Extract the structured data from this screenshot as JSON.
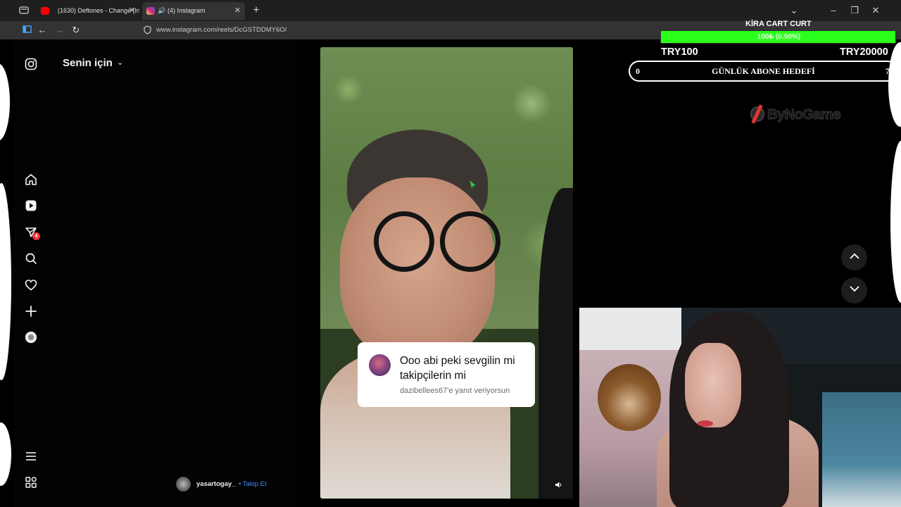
{
  "browser": {
    "tabs": [
      {
        "title": "(1630) Deftones - Change (In T",
        "favicon_color": "#ff0000"
      },
      {
        "title": "(4) Instagram",
        "favicon_color": "#d6249f"
      }
    ],
    "url": "www.instagram.com/reels/DcGSTDDMY6O/"
  },
  "instagram": {
    "feed_title": "Senin için",
    "notification_badge": "4",
    "comment": {
      "text": "Ooo abi peki sevgilin mi takipçilerin  mi",
      "reply_note": "dazibellees67'e yanıt veriyorsun"
    },
    "author": {
      "username": "yasartogay_",
      "follow_label": "• Takip Et"
    }
  },
  "overlay": {
    "goal": {
      "label": "KİRA CART CURT",
      "percent_text": "100₺ (0.50%)",
      "progress_fraction": 0.005,
      "min": "TRY100",
      "max": "TRY20000",
      "bar_color": "#2bff1c"
    },
    "subgoal": {
      "current": "0",
      "label": "GÜNLÜK ABONE HEDEFİ",
      "target": "7"
    },
    "brand": "ByNoGame"
  }
}
